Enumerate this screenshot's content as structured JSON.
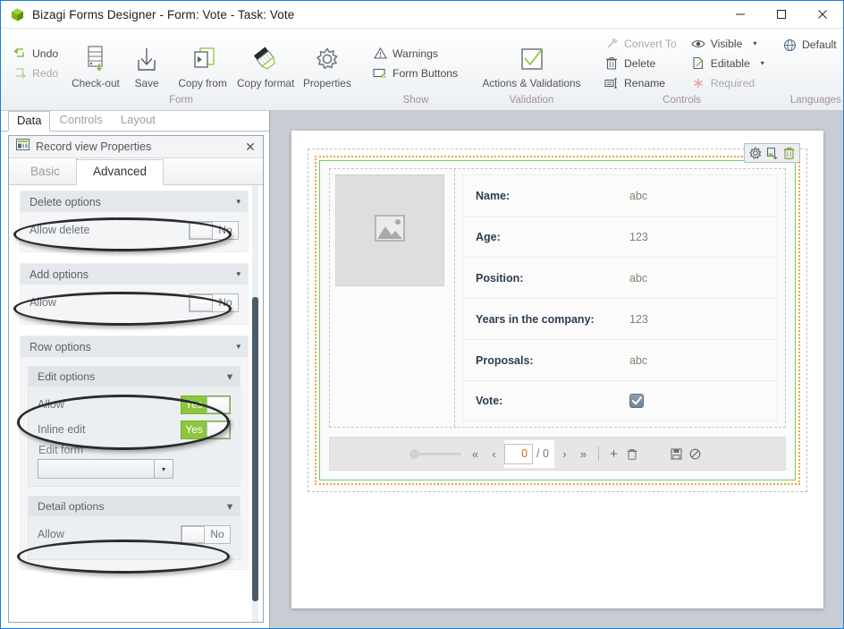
{
  "titlebar": {
    "app_icon": "bizagi-cube-icon",
    "title": "Bizagi Forms Designer  - Form: Vote - Task:  Vote",
    "minimize": "─",
    "maximize": "□",
    "close": "✕"
  },
  "ribbon": {
    "groups": [
      {
        "label": "Form",
        "small_items": [
          {
            "label": "Undo",
            "icon": "undo-arrow-icon",
            "disabled": false
          },
          {
            "label": "Redo",
            "icon": "redo-arrow-icon",
            "disabled": true
          }
        ],
        "big_items": [
          {
            "label": "Check-out",
            "icon": "check-out-icon"
          },
          {
            "label": "Save",
            "icon": "save-down-arrow-icon"
          },
          {
            "label": "Copy from",
            "icon": "copy-from-icon"
          },
          {
            "label": "Copy format",
            "icon": "copy-format-brush-icon"
          },
          {
            "label": "Properties",
            "icon": "gear-properties-icon"
          }
        ]
      },
      {
        "label": "Show",
        "small_items": [
          {
            "label": "Warnings",
            "icon": "warning-triangle-icon",
            "disabled": false
          },
          {
            "label": "Form Buttons",
            "icon": "form-buttons-icon",
            "disabled": false
          }
        ],
        "big_items": []
      },
      {
        "label": "Validation",
        "small_items": [],
        "big_items": [
          {
            "label": "Actions & Validations",
            "icon": "checkmark-box-icon"
          }
        ]
      },
      {
        "label": "Controls",
        "small_items": [
          {
            "label": "Convert To",
            "icon": "convert-to-icon",
            "disabled": true
          },
          {
            "label": "Delete",
            "icon": "trash-icon",
            "disabled": false
          },
          {
            "label": "Rename",
            "icon": "rename-icon",
            "disabled": false
          },
          {
            "label": "Visible",
            "icon": "eye-icon",
            "disabled": false,
            "caret": "▾"
          },
          {
            "label": "Editable",
            "icon": "pencil-page-icon",
            "disabled": false,
            "caret": "▾"
          },
          {
            "label": "Required",
            "icon": "asterisk-icon",
            "disabled": true
          }
        ],
        "big_items": []
      },
      {
        "label": "Languages",
        "small_items": [
          {
            "label": "Default",
            "icon": "globe-icon",
            "disabled": false,
            "caret": "▾"
          }
        ],
        "big_items": []
      }
    ]
  },
  "left_panel": {
    "tabs": [
      {
        "label": "Data",
        "active": true
      },
      {
        "label": "Controls",
        "active": false
      },
      {
        "label": "Layout",
        "active": false
      }
    ],
    "properties_window": {
      "icon": "record-view-icon",
      "title": "Record view Properties",
      "close_label": "✕",
      "tabs": [
        {
          "label": "Basic",
          "active": false
        },
        {
          "label": "Advanced",
          "active": true
        }
      ],
      "sections": [
        {
          "id": "delete-options",
          "title": "Delete options",
          "caret": "▾",
          "rows": [
            {
              "label": "Allow delete",
              "value": "No",
              "state": "off"
            }
          ]
        },
        {
          "id": "add-options",
          "title": "Add options",
          "caret": "▾",
          "rows": [
            {
              "label": "Allow",
              "value": "No",
              "state": "off"
            }
          ]
        },
        {
          "id": "row-options",
          "title": "Row options",
          "caret": "▾",
          "subsections": [
            {
              "id": "edit-options",
              "title": "Edit options",
              "caret": "▾",
              "rows": [
                {
                  "label": "Allow",
                  "value": "Yes",
                  "state": "on"
                },
                {
                  "label": "Inline edit",
                  "value": "Yes",
                  "state": "on"
                }
              ],
              "field_label": "Edit form",
              "field_value": "",
              "field_caret": "▾"
            },
            {
              "id": "detail-options",
              "title": "Detail options",
              "caret": "▾",
              "rows": [
                {
                  "label": "Allow",
                  "value": "No",
                  "state": "off"
                }
              ]
            }
          ]
        }
      ]
    }
  },
  "canvas": {
    "gadget_tools": [
      {
        "icon": "gear-icon",
        "glyph": "gear"
      },
      {
        "icon": "duplicate-icon",
        "glyph": "duplicate"
      },
      {
        "icon": "trash-icon",
        "glyph": "trash"
      }
    ],
    "image_placeholder_icon": "image-placeholder-icon",
    "fields": [
      {
        "label": "Name:",
        "value": "abc",
        "type": "text"
      },
      {
        "label": "Age:",
        "value": "123",
        "type": "number"
      },
      {
        "label": "Position:",
        "value": "abc",
        "type": "text"
      },
      {
        "label": "Years in the company:",
        "value": "123",
        "type": "number"
      },
      {
        "label": "Proposals:",
        "value": "abc",
        "type": "text"
      },
      {
        "label": "Vote:",
        "value": "",
        "type": "checkbox",
        "checked": true
      }
    ],
    "pager": {
      "first": "«",
      "prev": "‹",
      "page_value": "0",
      "page_total": "/ 0",
      "next": "›",
      "last": "»",
      "add": "+",
      "delete_icon": "trash-icon",
      "save_icon": "floppy-save-icon",
      "cancel_icon": "cancel-circle-icon"
    }
  },
  "colors": {
    "accent_green": "#8cc63f",
    "window_border_blue": "#1a7fd4",
    "selection_orange": "#f0a830",
    "gadget_green": "#6fd06f",
    "checkbox_blue": "#6f8396",
    "group_label_purple": "#9f8fa8",
    "value_text": "#8a7f6d"
  }
}
